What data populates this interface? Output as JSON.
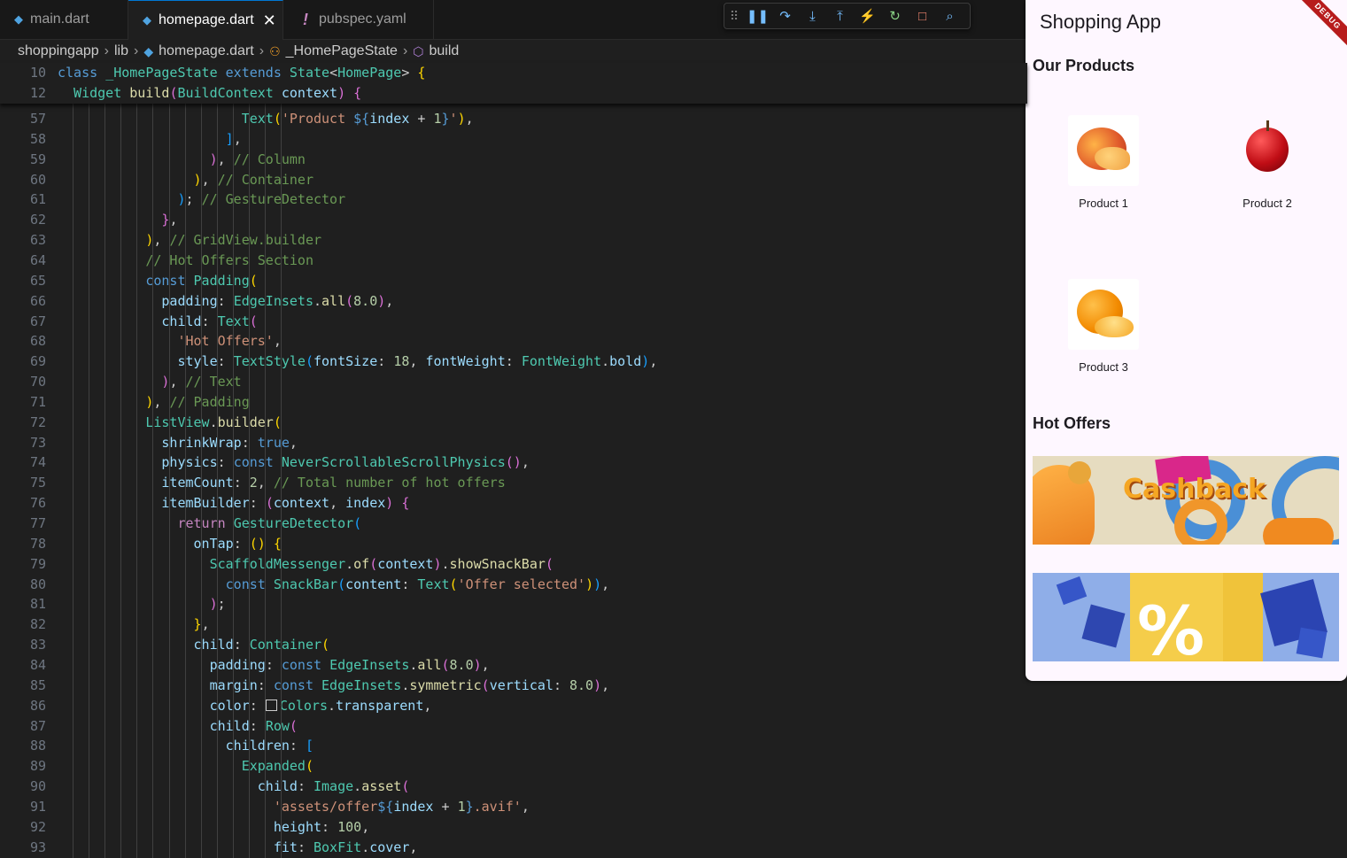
{
  "tabs": [
    {
      "label": "main.dart",
      "type": "dart"
    },
    {
      "label": "homepage.dart",
      "type": "dart",
      "active": true
    },
    {
      "label": "pubspec.yaml",
      "type": "yaml"
    }
  ],
  "debug_toolbar": {
    "icons": [
      "grip-icon",
      "pause-icon",
      "step-over-icon",
      "step-into-icon",
      "step-out-icon",
      "hot-reload-icon",
      "restart-icon",
      "stop-icon",
      "devtools-icon"
    ]
  },
  "breadcrumb": [
    "shoppingapp",
    "lib",
    "homepage.dart",
    "_HomePageState",
    "build"
  ],
  "sticky_lines": [
    {
      "n": "10",
      "parts": [
        [
          "kw",
          "class "
        ],
        [
          "ty",
          "_HomePageState "
        ],
        [
          "kw",
          "extends "
        ],
        [
          "ty",
          "State"
        ],
        [
          "pl",
          "<"
        ],
        [
          "ty",
          "HomePage"
        ],
        [
          "pl",
          "> "
        ],
        [
          "b1",
          "{"
        ]
      ]
    },
    {
      "n": "12",
      "parts": [
        [
          "ty",
          "  Widget "
        ],
        [
          "fn",
          "build"
        ],
        [
          "b2",
          "("
        ],
        [
          "ty",
          "BuildContext "
        ],
        [
          "pr",
          "context"
        ],
        [
          "b2",
          ")"
        ],
        [
          "pl",
          " "
        ],
        [
          "b2",
          "{"
        ]
      ]
    }
  ],
  "code_lines": [
    {
      "n": "57",
      "parts": [
        [
          "pl",
          "                       "
        ],
        [
          "ty",
          "Text"
        ],
        [
          "b1",
          "("
        ],
        [
          "st",
          "'Product "
        ],
        [
          "kw",
          "${"
        ],
        [
          "pr",
          "index"
        ],
        [
          "pl",
          " + "
        ],
        [
          "nu",
          "1"
        ],
        [
          "kw",
          "}"
        ],
        [
          "st",
          "'"
        ],
        [
          "b1",
          ")"
        ],
        [
          "pl",
          ","
        ]
      ]
    },
    {
      "n": "58",
      "parts": [
        [
          "pl",
          "                     "
        ],
        [
          "b3",
          "]"
        ],
        [
          "pl",
          ","
        ]
      ]
    },
    {
      "n": "59",
      "parts": [
        [
          "pl",
          "                   "
        ],
        [
          "b2",
          ")"
        ],
        [
          "pl",
          ", "
        ],
        [
          "cm",
          "// Column"
        ]
      ]
    },
    {
      "n": "60",
      "parts": [
        [
          "pl",
          "                 "
        ],
        [
          "b1",
          ")"
        ],
        [
          "pl",
          ", "
        ],
        [
          "cm",
          "// Container"
        ]
      ]
    },
    {
      "n": "61",
      "parts": [
        [
          "pl",
          "               "
        ],
        [
          "b3",
          ")"
        ],
        [
          "pl",
          "; "
        ],
        [
          "cm",
          "// GestureDetector"
        ]
      ]
    },
    {
      "n": "62",
      "parts": [
        [
          "pl",
          "             "
        ],
        [
          "b2",
          "}"
        ],
        [
          "pl",
          ","
        ]
      ]
    },
    {
      "n": "63",
      "parts": [
        [
          "pl",
          "           "
        ],
        [
          "b1",
          ")"
        ],
        [
          "pl",
          ", "
        ],
        [
          "cm",
          "// GridView.builder"
        ]
      ]
    },
    {
      "n": "64",
      "parts": [
        [
          "pl",
          "           "
        ],
        [
          "cm",
          "// Hot Offers Section"
        ]
      ]
    },
    {
      "n": "65",
      "parts": [
        [
          "pl",
          "           "
        ],
        [
          "kw",
          "const "
        ],
        [
          "ty",
          "Padding"
        ],
        [
          "b1",
          "("
        ]
      ]
    },
    {
      "n": "66",
      "parts": [
        [
          "pl",
          "             "
        ],
        [
          "pr",
          "padding"
        ],
        [
          "pl",
          ": "
        ],
        [
          "ty",
          "EdgeInsets"
        ],
        [
          "pl",
          "."
        ],
        [
          "fn",
          "all"
        ],
        [
          "b2",
          "("
        ],
        [
          "nu",
          "8.0"
        ],
        [
          "b2",
          ")"
        ],
        [
          "pl",
          ","
        ]
      ]
    },
    {
      "n": "67",
      "parts": [
        [
          "pl",
          "             "
        ],
        [
          "pr",
          "child"
        ],
        [
          "pl",
          ": "
        ],
        [
          "ty",
          "Text"
        ],
        [
          "b2",
          "("
        ]
      ]
    },
    {
      "n": "68",
      "parts": [
        [
          "pl",
          "               "
        ],
        [
          "st",
          "'Hot Offers'"
        ],
        [
          "pl",
          ","
        ]
      ]
    },
    {
      "n": "69",
      "parts": [
        [
          "pl",
          "               "
        ],
        [
          "pr",
          "style"
        ],
        [
          "pl",
          ": "
        ],
        [
          "ty",
          "TextStyle"
        ],
        [
          "b3",
          "("
        ],
        [
          "pr",
          "fontSize"
        ],
        [
          "pl",
          ": "
        ],
        [
          "nu",
          "18"
        ],
        [
          "pl",
          ", "
        ],
        [
          "pr",
          "fontWeight"
        ],
        [
          "pl",
          ": "
        ],
        [
          "ty",
          "FontWeight"
        ],
        [
          "pl",
          "."
        ],
        [
          "pr",
          "bold"
        ],
        [
          "b3",
          ")"
        ],
        [
          "pl",
          ","
        ]
      ]
    },
    {
      "n": "70",
      "parts": [
        [
          "pl",
          "             "
        ],
        [
          "b2",
          ")"
        ],
        [
          "pl",
          ", "
        ],
        [
          "cm",
          "// Text"
        ]
      ]
    },
    {
      "n": "71",
      "parts": [
        [
          "pl",
          "           "
        ],
        [
          "b1",
          ")"
        ],
        [
          "pl",
          ", "
        ],
        [
          "cm",
          "// Padding"
        ]
      ]
    },
    {
      "n": "72",
      "parts": [
        [
          "pl",
          "           "
        ],
        [
          "ty",
          "ListView"
        ],
        [
          "pl",
          "."
        ],
        [
          "fn",
          "builder"
        ],
        [
          "b1",
          "("
        ]
      ]
    },
    {
      "n": "73",
      "parts": [
        [
          "pl",
          "             "
        ],
        [
          "pr",
          "shrinkWrap"
        ],
        [
          "pl",
          ": "
        ],
        [
          "kw",
          "true"
        ],
        [
          "pl",
          ","
        ]
      ]
    },
    {
      "n": "74",
      "parts": [
        [
          "pl",
          "             "
        ],
        [
          "pr",
          "physics"
        ],
        [
          "pl",
          ": "
        ],
        [
          "kw",
          "const "
        ],
        [
          "ty",
          "NeverScrollableScrollPhysics"
        ],
        [
          "b2",
          "()"
        ],
        [
          "pl",
          ","
        ]
      ]
    },
    {
      "n": "75",
      "parts": [
        [
          "pl",
          "             "
        ],
        [
          "pr",
          "itemCount"
        ],
        [
          "pl",
          ": "
        ],
        [
          "nu",
          "2"
        ],
        [
          "pl",
          ", "
        ],
        [
          "cm",
          "// Total number of hot offers"
        ]
      ]
    },
    {
      "n": "76",
      "parts": [
        [
          "pl",
          "             "
        ],
        [
          "pr",
          "itemBuilder"
        ],
        [
          "pl",
          ": "
        ],
        [
          "b2",
          "("
        ],
        [
          "pr",
          "context"
        ],
        [
          "pl",
          ", "
        ],
        [
          "pr",
          "index"
        ],
        [
          "b2",
          ")"
        ],
        [
          "pl",
          " "
        ],
        [
          "b2",
          "{"
        ]
      ]
    },
    {
      "n": "77",
      "parts": [
        [
          "pl",
          "               "
        ],
        [
          "cf",
          "return "
        ],
        [
          "ty",
          "GestureDetector"
        ],
        [
          "b3",
          "("
        ]
      ]
    },
    {
      "n": "78",
      "parts": [
        [
          "pl",
          "                 "
        ],
        [
          "pr",
          "onTap"
        ],
        [
          "pl",
          ": "
        ],
        [
          "b1",
          "()"
        ],
        [
          "pl",
          " "
        ],
        [
          "b1",
          "{"
        ]
      ]
    },
    {
      "n": "79",
      "parts": [
        [
          "pl",
          "                   "
        ],
        [
          "ty",
          "ScaffoldMessenger"
        ],
        [
          "pl",
          "."
        ],
        [
          "fn",
          "of"
        ],
        [
          "b2",
          "("
        ],
        [
          "pr",
          "context"
        ],
        [
          "b2",
          ")"
        ],
        [
          "pl",
          "."
        ],
        [
          "fn",
          "showSnackBar"
        ],
        [
          "b2",
          "("
        ]
      ]
    },
    {
      "n": "80",
      "parts": [
        [
          "pl",
          "                     "
        ],
        [
          "kw",
          "const "
        ],
        [
          "ty",
          "SnackBar"
        ],
        [
          "b3",
          "("
        ],
        [
          "pr",
          "content"
        ],
        [
          "pl",
          ": "
        ],
        [
          "ty",
          "Text"
        ],
        [
          "b1",
          "("
        ],
        [
          "st",
          "'Offer selected'"
        ],
        [
          "b1",
          ")"
        ],
        [
          "b3",
          ")"
        ],
        [
          "pl",
          ","
        ]
      ]
    },
    {
      "n": "81",
      "parts": [
        [
          "pl",
          "                   "
        ],
        [
          "b2",
          ")"
        ],
        [
          "pl",
          ";"
        ]
      ]
    },
    {
      "n": "82",
      "parts": [
        [
          "pl",
          "                 "
        ],
        [
          "b1",
          "}"
        ],
        [
          "pl",
          ","
        ]
      ]
    },
    {
      "n": "83",
      "parts": [
        [
          "pl",
          "                 "
        ],
        [
          "pr",
          "child"
        ],
        [
          "pl",
          ": "
        ],
        [
          "ty",
          "Container"
        ],
        [
          "b1",
          "("
        ]
      ]
    },
    {
      "n": "84",
      "parts": [
        [
          "pl",
          "                   "
        ],
        [
          "pr",
          "padding"
        ],
        [
          "pl",
          ": "
        ],
        [
          "kw",
          "const "
        ],
        [
          "ty",
          "EdgeInsets"
        ],
        [
          "pl",
          "."
        ],
        [
          "fn",
          "all"
        ],
        [
          "b2",
          "("
        ],
        [
          "nu",
          "8.0"
        ],
        [
          "b2",
          ")"
        ],
        [
          "pl",
          ","
        ]
      ]
    },
    {
      "n": "85",
      "parts": [
        [
          "pl",
          "                   "
        ],
        [
          "pr",
          "margin"
        ],
        [
          "pl",
          ": "
        ],
        [
          "kw",
          "const "
        ],
        [
          "ty",
          "EdgeInsets"
        ],
        [
          "pl",
          "."
        ],
        [
          "fn",
          "symmetric"
        ],
        [
          "b2",
          "("
        ],
        [
          "pr",
          "vertical"
        ],
        [
          "pl",
          ": "
        ],
        [
          "nu",
          "8.0"
        ],
        [
          "b2",
          ")"
        ],
        [
          "pl",
          ","
        ]
      ]
    },
    {
      "n": "86",
      "parts": [
        [
          "pl",
          "                   "
        ],
        [
          "pr",
          "color"
        ],
        [
          "pl",
          ": "
        ],
        [
          "swatch",
          ""
        ],
        [
          "ty",
          "Colors"
        ],
        [
          "pl",
          "."
        ],
        [
          "pr",
          "transparent"
        ],
        [
          "pl",
          ","
        ]
      ]
    },
    {
      "n": "87",
      "parts": [
        [
          "pl",
          "                   "
        ],
        [
          "pr",
          "child"
        ],
        [
          "pl",
          ": "
        ],
        [
          "ty",
          "Row"
        ],
        [
          "b2",
          "("
        ]
      ]
    },
    {
      "n": "88",
      "parts": [
        [
          "pl",
          "                     "
        ],
        [
          "pr",
          "children"
        ],
        [
          "pl",
          ": "
        ],
        [
          "b3",
          "["
        ]
      ]
    },
    {
      "n": "89",
      "parts": [
        [
          "pl",
          "                       "
        ],
        [
          "ty",
          "Expanded"
        ],
        [
          "b1",
          "("
        ]
      ]
    },
    {
      "n": "90",
      "parts": [
        [
          "pl",
          "                         "
        ],
        [
          "pr",
          "child"
        ],
        [
          "pl",
          ": "
        ],
        [
          "ty",
          "Image"
        ],
        [
          "pl",
          "."
        ],
        [
          "fn",
          "asset"
        ],
        [
          "b2",
          "("
        ]
      ]
    },
    {
      "n": "91",
      "parts": [
        [
          "pl",
          "                           "
        ],
        [
          "st",
          "'assets/offer"
        ],
        [
          "kw",
          "${"
        ],
        [
          "pr",
          "index"
        ],
        [
          "pl",
          " + "
        ],
        [
          "nu",
          "1"
        ],
        [
          "kw",
          "}"
        ],
        [
          "st",
          ".avif'"
        ],
        [
          "pl",
          ","
        ]
      ]
    },
    {
      "n": "92",
      "parts": [
        [
          "pl",
          "                           "
        ],
        [
          "pr",
          "height"
        ],
        [
          "pl",
          ": "
        ],
        [
          "nu",
          "100"
        ],
        [
          "pl",
          ","
        ]
      ]
    },
    {
      "n": "93",
      "parts": [
        [
          "pl",
          "                           "
        ],
        [
          "pr",
          "fit"
        ],
        [
          "pl",
          ": "
        ],
        [
          "ty",
          "BoxFit"
        ],
        [
          "pl",
          "."
        ],
        [
          "pr",
          "cover"
        ],
        [
          "pl",
          ","
        ]
      ]
    }
  ],
  "app": {
    "title": "Shopping App",
    "debug_banner": "DEBUG",
    "section_products": "Our Products",
    "products": [
      {
        "label": "Product 1",
        "icon": "peach-image"
      },
      {
        "label": "Product 2",
        "icon": "apple-image"
      },
      {
        "label": "Product 3",
        "icon": "orange-image"
      }
    ],
    "section_offers": "Hot Offers",
    "offers": [
      {
        "text": "Cashback",
        "icon": "cashback-banner-image"
      },
      {
        "text": "%",
        "icon": "discount-banner-image"
      }
    ]
  }
}
